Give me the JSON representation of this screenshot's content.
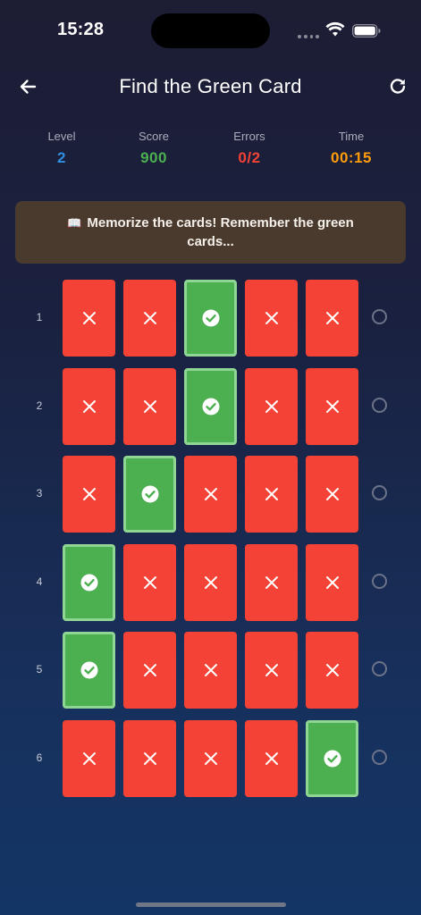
{
  "status_bar": {
    "time": "15:28"
  },
  "header": {
    "title": "Find the Green Card",
    "back_icon": "arrow-left-icon",
    "refresh_icon": "refresh-icon"
  },
  "stats": {
    "level": {
      "label": "Level",
      "value": "2",
      "color": "#2f8fe0"
    },
    "score": {
      "label": "Score",
      "value": "900",
      "color": "#4caf50"
    },
    "errors": {
      "label": "Errors",
      "value": "0/2",
      "color": "#f44336"
    },
    "time": {
      "label": "Time",
      "value": "00:15",
      "color": "#ff9d0a"
    }
  },
  "banner": {
    "icon": "📖",
    "text": "Memorize the cards! Remember the green cards..."
  },
  "colors": {
    "red_card": "#f44336",
    "green_card": "#4caf50",
    "banner_bg": "#4a3a2e"
  },
  "grid": {
    "rows": [
      {
        "label": "1",
        "cards": [
          "red",
          "red",
          "green",
          "red",
          "red"
        ]
      },
      {
        "label": "2",
        "cards": [
          "red",
          "red",
          "green",
          "red",
          "red"
        ]
      },
      {
        "label": "3",
        "cards": [
          "red",
          "green",
          "red",
          "red",
          "red"
        ]
      },
      {
        "label": "4",
        "cards": [
          "green",
          "red",
          "red",
          "red",
          "red"
        ]
      },
      {
        "label": "5",
        "cards": [
          "green",
          "red",
          "red",
          "red",
          "red"
        ]
      },
      {
        "label": "6",
        "cards": [
          "red",
          "red",
          "red",
          "red",
          "green"
        ]
      }
    ]
  }
}
